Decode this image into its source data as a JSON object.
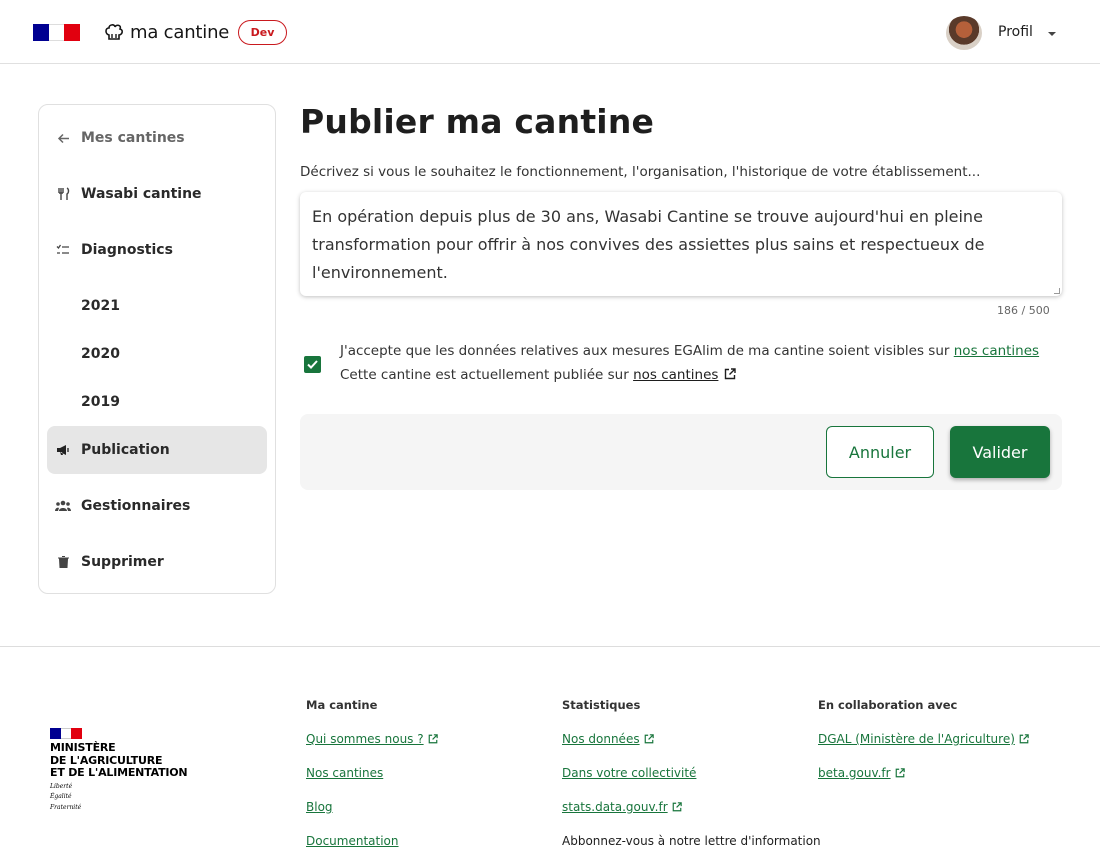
{
  "header": {
    "brand_name": "ma cantine",
    "env_badge": "Dev",
    "profile_label": "Profil"
  },
  "sidebar": {
    "items": [
      {
        "label": "Mes cantines",
        "icon": "arrow-left-icon"
      },
      {
        "label": "Wasabi cantine",
        "icon": "fork-knife-icon"
      },
      {
        "label": "Diagnostics",
        "icon": "checklist-icon"
      },
      {
        "label": "2021"
      },
      {
        "label": "2020"
      },
      {
        "label": "2019"
      },
      {
        "label": "Publication",
        "icon": "megaphone-icon",
        "active": true
      },
      {
        "label": "Gestionnaires",
        "icon": "people-icon"
      },
      {
        "label": "Supprimer",
        "icon": "trash-icon"
      }
    ]
  },
  "main": {
    "title": "Publier ma cantine",
    "description_label": "Décrivez si vous le souhaitez le fonctionnement, l'organisation, l'historique de votre établissement...",
    "description_value": "En opération depuis plus de 30 ans, Wasabi Cantine se trouve aujourd'hui en pleine transformation pour offrir à nos convives des assiettes plus sains et respectueux de l'environnement.",
    "char_counter": "186 / 500",
    "consent_text": "J'accepte que les données relatives aux mesures EGAlim de ma cantine soient visibles sur",
    "consent_link": "nos cantines",
    "consent_checked": true,
    "published_text": "Cette cantine est actuellement publiée sur",
    "published_link": "nos cantines",
    "cancel_label": "Annuler",
    "validate_label": "Valider"
  },
  "footer": {
    "ministry_lines": [
      "MINISTÈRE",
      "DE L'AGRICULTURE",
      "ET DE L'ALIMENTATION"
    ],
    "motto_lines": [
      "Liberté",
      "Égalité",
      "Fraternité"
    ],
    "col1": {
      "title": "Ma cantine",
      "links": [
        "Qui sommes nous ?",
        "Nos cantines",
        "Blog",
        "Documentation"
      ]
    },
    "col2": {
      "title": "Statistiques",
      "links": [
        "Nos données",
        "Dans votre collectivité",
        "stats.data.gouv.fr"
      ],
      "extra": "Abbonnez-vous à notre lettre d'information"
    },
    "col3": {
      "title": "En collaboration avec",
      "links": [
        "DGAL (Ministère de l'Agriculture)",
        "beta.gouv.fr"
      ]
    }
  },
  "colors": {
    "primary_green": "#18753c",
    "badge_red": "#c9191e",
    "flag_blue": "#000091",
    "flag_red": "#e1000f"
  }
}
